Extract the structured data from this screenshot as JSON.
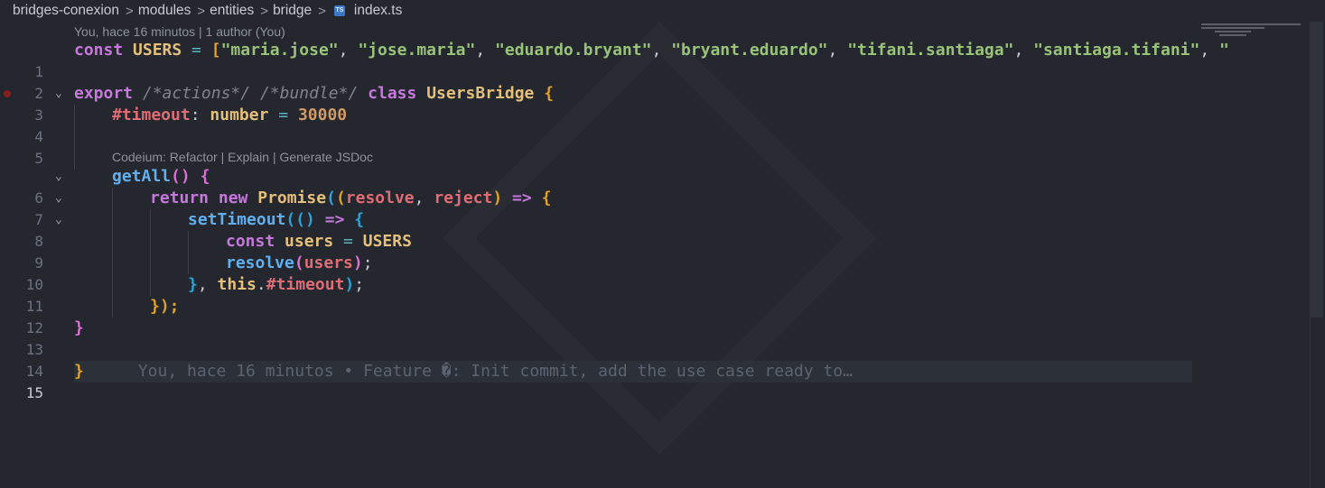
{
  "breadcrumb": {
    "items": [
      "bridges-conexion",
      "modules",
      "entities",
      "bridge"
    ],
    "file": "index.ts",
    "file_icon": "typescript-icon",
    "separator": ">"
  },
  "codelens": {
    "blame": "You, hace 16 minutos | 1 author (You)",
    "codeium": "Codeium: Refactor | Explain | Generate JSDoc"
  },
  "line_numbers": [
    "1",
    "2",
    "3",
    "4",
    "5",
    "6",
    "7",
    "8",
    "9",
    "10",
    "11",
    "12",
    "13",
    "14",
    "15"
  ],
  "code": {
    "l1": {
      "const": "const",
      "name": "USERS",
      "eq": " = ",
      "open": "[",
      "s1": "\"maria.jose\"",
      "s2": "\"jose.maria\"",
      "s3": "\"eduardo.bryant\"",
      "s4": "\"bryant.eduardo\"",
      "s5": "\"tifani.santiaga\"",
      "s6": "\"santiaga.tifani\"",
      "s7": "\"",
      "comma": ", "
    },
    "l3": {
      "export": "export",
      "c1": "/*actions*/",
      "c2": "/*bundle*/",
      "class": "class",
      "name": "UsersBridge",
      "brace": "{"
    },
    "l4": {
      "prop": "#timeout",
      "colon": ": ",
      "type": "number",
      "eq": " = ",
      "val": "30000"
    },
    "l6": {
      "fn": "getAll",
      "parens": "()",
      "brace": "{"
    },
    "l7": {
      "return": "return",
      "new": "new",
      "cls": "Promise",
      "p1": "resolve",
      "p2": "reject",
      "arrow": "=>",
      "brace": "{"
    },
    "l8": {
      "fn": "setTimeout",
      "arrow": "=>",
      "brace": "{"
    },
    "l9": {
      "const": "const",
      "var": "users",
      "eq": " = ",
      "val": "USERS"
    },
    "l10": {
      "fn": "resolve",
      "arg": "users",
      "end": ";"
    },
    "l11": {
      "close": "}",
      "comma": ", ",
      "this": "this",
      "dot": ".",
      "prop": "#timeout",
      "end": ";"
    },
    "l12": {
      "close": "});"
    },
    "l13": {
      "close": "}"
    },
    "l15": {
      "close": "}",
      "blame": "You, hace 16 minutos • Feature �: Init commit, add the use case ready to…"
    }
  },
  "colors": {
    "background": "#24272e",
    "keyword": "#c678dd",
    "string": "#98c379",
    "number": "#d19a66",
    "function": "#61afef",
    "property": "#e06c75",
    "constant": "#e5c07b"
  }
}
